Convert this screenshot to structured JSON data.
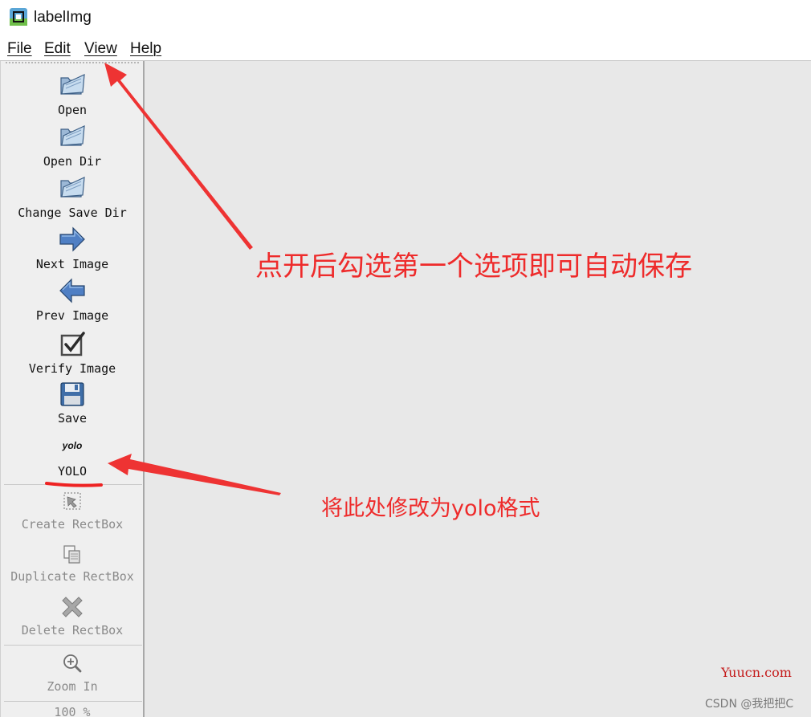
{
  "window": {
    "title": "labelImg"
  },
  "menu": [
    {
      "label": "File"
    },
    {
      "label": "Edit"
    },
    {
      "label": "View"
    },
    {
      "label": "Help"
    }
  ],
  "toolbar": {
    "open": "Open",
    "open_dir": "Open Dir",
    "change_save_dir": "Change Save Dir",
    "next_image": "Next Image",
    "prev_image": "Prev Image",
    "verify_image": "Verify Image",
    "save": "Save",
    "format_icon_text": "yolo",
    "format": "YOLO",
    "create_rectbox": "Create RectBox",
    "duplicate_rectbox": "Duplicate RectBox",
    "delete_rectbox": "Delete RectBox",
    "zoom_in": "Zoom In",
    "zoom_level": "100 %"
  },
  "annotations": {
    "view_menu_note": "点开后勾选第一个选项即可自动保存",
    "format_note": "将此处修改为yolo格式"
  },
  "watermarks": {
    "site": "Yuucn.com",
    "credit": "CSDN @我把把C"
  },
  "colors": {
    "annotation_red": "#ee2b2b",
    "canvas_gray": "#e8e8e8",
    "toolbar_bg": "#efefef"
  }
}
